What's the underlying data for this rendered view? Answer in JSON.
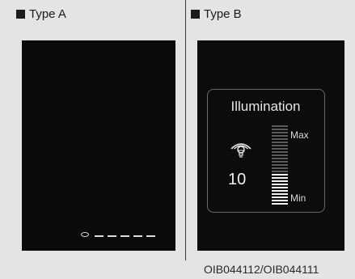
{
  "panels": {
    "type_a": {
      "label": "Type A"
    },
    "type_b": {
      "label": "Type B"
    }
  },
  "illumination": {
    "title": "Illumination",
    "value": "10",
    "level_fraction": 0.4,
    "scale_max_label": "Max",
    "scale_min_label": "Min",
    "icon": "dashboard-light-icon"
  },
  "type_a_indicator": {
    "icon": "ring-dash-level-icon"
  },
  "figure_code": "OIB044112/OIB044111"
}
